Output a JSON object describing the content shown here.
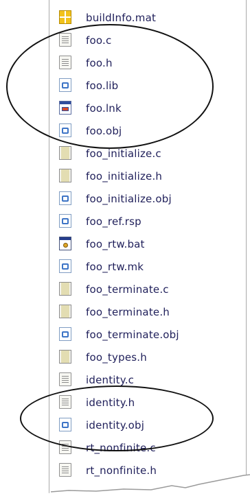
{
  "colors": {
    "text": "#1f1f5a",
    "panel_border": "#a9a9a9",
    "annotation": "#111111"
  },
  "files": [
    {
      "name": "buildInfo.mat",
      "icon": "mat-file-icon"
    },
    {
      "name": "foo.c",
      "icon": "c-source-icon"
    },
    {
      "name": "foo.h",
      "icon": "header-icon"
    },
    {
      "name": "foo.lib",
      "icon": "lib-file-icon"
    },
    {
      "name": "foo.lnk",
      "icon": "shortcut-icon"
    },
    {
      "name": "foo.obj",
      "icon": "obj-file-icon"
    },
    {
      "name": "foo_initialize.c",
      "icon": "c-source-icon"
    },
    {
      "name": "foo_initialize.h",
      "icon": "header-icon"
    },
    {
      "name": "foo_initialize.obj",
      "icon": "obj-file-icon"
    },
    {
      "name": "foo_ref.rsp",
      "icon": "rsp-file-icon"
    },
    {
      "name": "foo_rtw.bat",
      "icon": "batch-file-icon"
    },
    {
      "name": "foo_rtw.mk",
      "icon": "makefile-icon"
    },
    {
      "name": "foo_terminate.c",
      "icon": "c-source-icon"
    },
    {
      "name": "foo_terminate.h",
      "icon": "header-icon"
    },
    {
      "name": "foo_terminate.obj",
      "icon": "obj-file-icon"
    },
    {
      "name": "foo_types.h",
      "icon": "header-icon"
    },
    {
      "name": "identity.c",
      "icon": "c-source-icon"
    },
    {
      "name": "identity.h",
      "icon": "header-icon"
    },
    {
      "name": "identity.obj",
      "icon": "obj-file-icon"
    },
    {
      "name": "rt_nonfinite.c",
      "icon": "c-source-icon"
    },
    {
      "name": "rt_nonfinite.h",
      "icon": "header-icon"
    }
  ]
}
